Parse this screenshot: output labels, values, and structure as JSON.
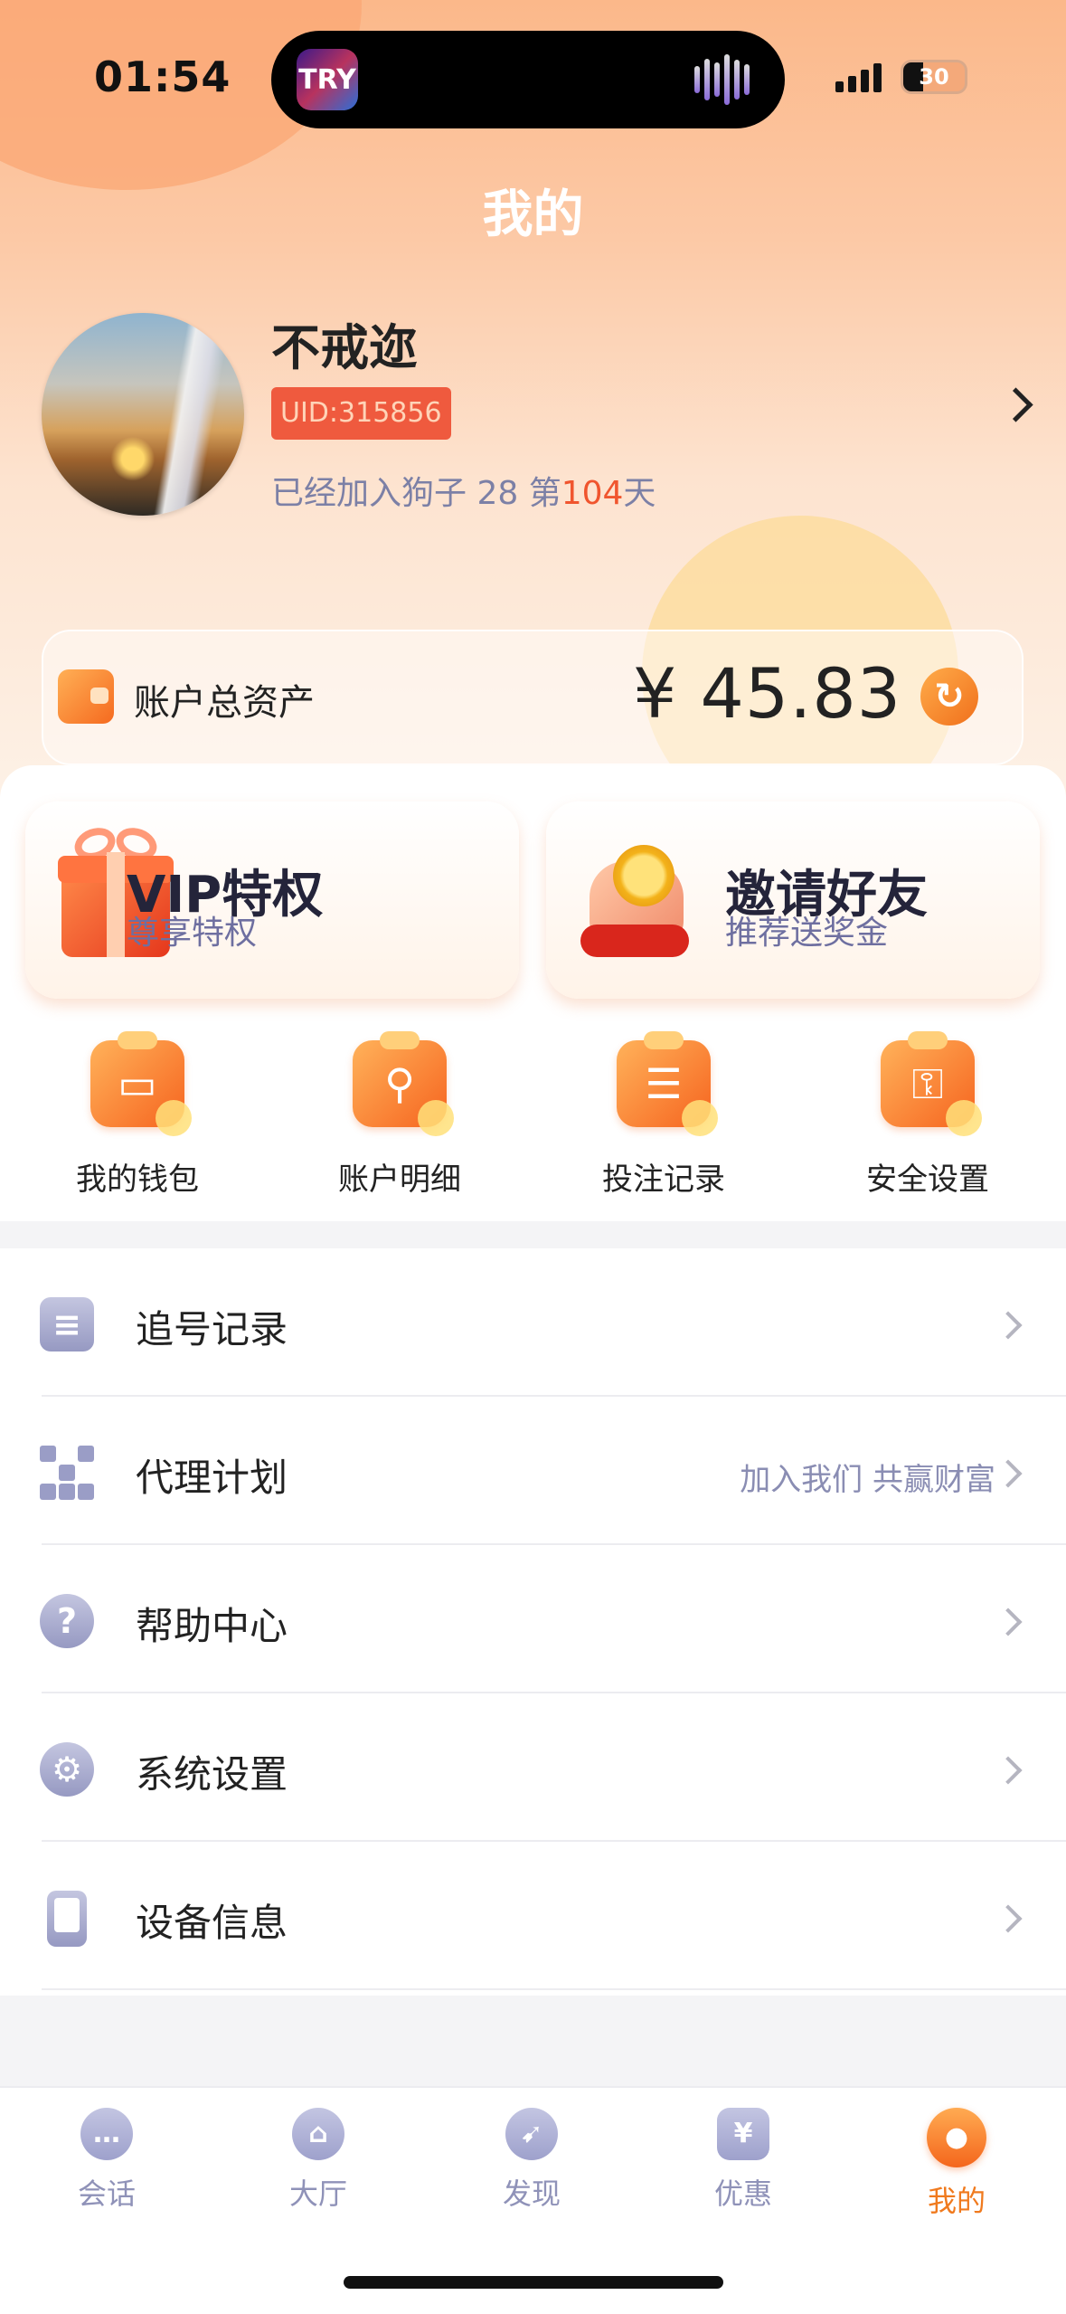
{
  "status_bar": {
    "time": "01:54",
    "island_app_label": "TRY",
    "battery": "30"
  },
  "header": {
    "title": "我的"
  },
  "profile": {
    "username": "不戒迩",
    "uid": "UID:315856",
    "join_prefix": "已经加入狗子 28 第",
    "join_days": "104",
    "join_suffix": "天"
  },
  "assets": {
    "label": "账户总资产",
    "value": "¥ 45.83",
    "refresh_icon": "refresh-icon"
  },
  "promos": [
    {
      "title": "VIP特权",
      "subtitle": "尊享特权",
      "icon": "gift-icon"
    },
    {
      "title": "邀请好友",
      "subtitle": "推荐送奖金",
      "icon": "coin-hand-icon"
    }
  ],
  "quick_actions": [
    {
      "label": "我的钱包",
      "glyph": "▭",
      "icon": "wallet-icon"
    },
    {
      "label": "账户明细",
      "glyph": "⚲",
      "icon": "search-icon"
    },
    {
      "label": "投注记录",
      "glyph": "☰",
      "icon": "clipboard-icon"
    },
    {
      "label": "安全设置",
      "glyph": "⚿",
      "icon": "key-icon"
    }
  ],
  "menu": [
    {
      "label": "追号记录",
      "hint": "",
      "icon": "document-icon"
    },
    {
      "label": "代理计划",
      "hint": "加入我们 共赢财富",
      "icon": "qr-code-icon"
    },
    {
      "label": "帮助中心",
      "hint": "",
      "icon": "help-icon",
      "glyph": "?"
    },
    {
      "label": "系统设置",
      "hint": "",
      "icon": "gear-icon",
      "glyph": "⚙"
    },
    {
      "label": "设备信息",
      "hint": "",
      "icon": "phone-icon"
    }
  ],
  "tabs": [
    {
      "label": "会话",
      "glyph": "…",
      "icon": "chat-icon"
    },
    {
      "label": "大厅",
      "glyph": "⌂",
      "icon": "bank-icon"
    },
    {
      "label": "发现",
      "glyph": "➹",
      "icon": "compass-icon"
    },
    {
      "label": "优惠",
      "glyph": "¥",
      "icon": "coupon-icon"
    },
    {
      "label": "我的",
      "glyph": "●",
      "icon": "profile-icon",
      "active": true
    }
  ],
  "colors": {
    "accent": "#f07a1e",
    "uid_badge": "#ef5a3e",
    "highlight": "#f0552e",
    "muted_icon": "#9ea1cc"
  }
}
